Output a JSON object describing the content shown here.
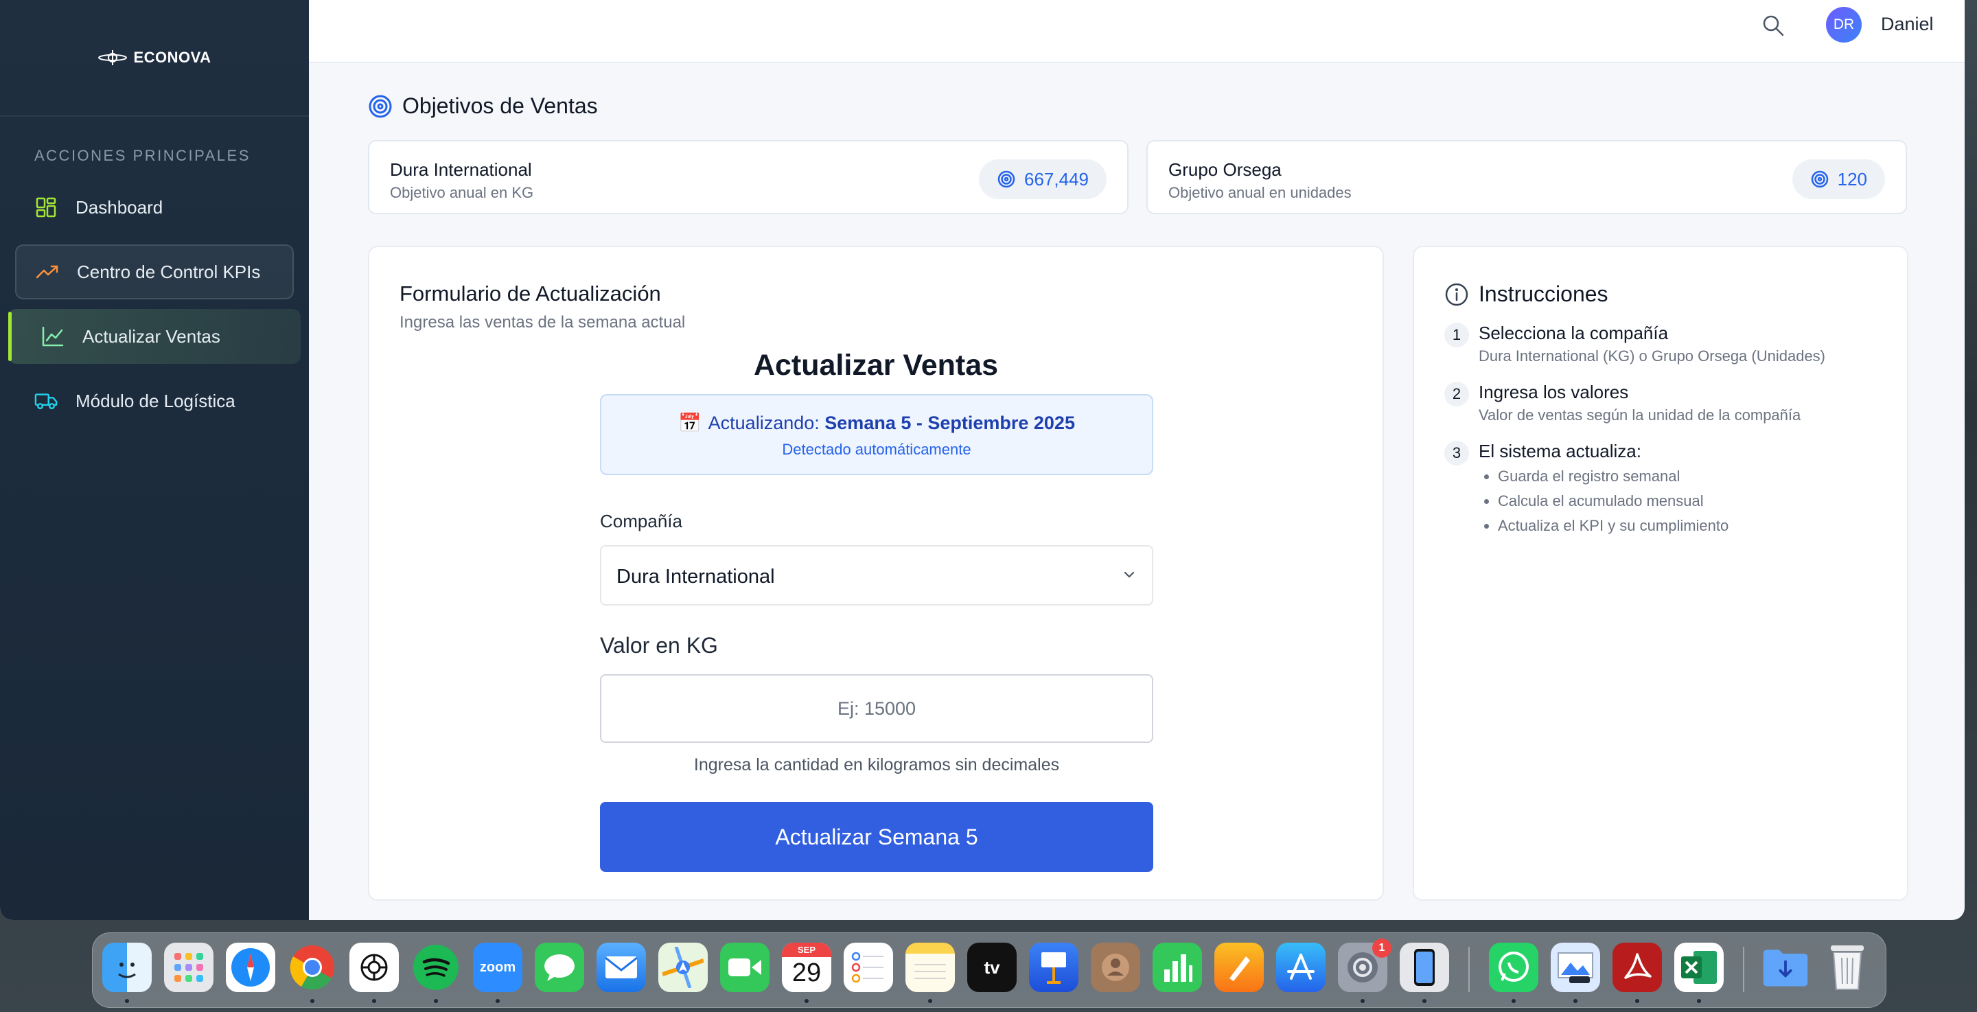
{
  "sidebar": {
    "logo_text": "ECONOVA",
    "section_title": "ACCIONES PRINCIPALES",
    "items": [
      {
        "label": "Dashboard",
        "icon": "grid-icon"
      },
      {
        "label": "Centro de Control KPIs",
        "icon": "trending-up-icon"
      },
      {
        "label": "Actualizar Ventas",
        "icon": "line-chart-icon",
        "active": true
      },
      {
        "label": "Módulo de Logística",
        "icon": "truck-icon"
      }
    ]
  },
  "header": {
    "avatar_initials": "DR",
    "user_name": "Daniel"
  },
  "page": {
    "title": "Objetivos de Ventas"
  },
  "targets": [
    {
      "name": "Dura International",
      "subtitle": "Objetivo anual en KG",
      "value": "667,449"
    },
    {
      "name": "Grupo Orsega",
      "subtitle": "Objetivo anual en unidades",
      "value": "120"
    }
  ],
  "form": {
    "title": "Formulario de Actualización",
    "subtitle": "Ingresa las ventas de la semana actual",
    "heading": "Actualizar Ventas",
    "week_emoji": "📅",
    "week_prefix": "Actualizando:",
    "week_value": "Semana 5 - Septiembre 2025",
    "week_detected": "Detectado automáticamente",
    "company_label": "Compañía",
    "company_selected": "Dura International",
    "value_label": "Valor en KG",
    "value_placeholder": "Ej: 15000",
    "value_hint": "Ingresa la cantidad en kilogramos sin decimales",
    "submit_label": "Actualizar Semana 5"
  },
  "instructions": {
    "title": "Instrucciones",
    "steps": [
      {
        "num": "1",
        "title": "Selecciona la compañía",
        "desc": "Dura International (KG) o Grupo Orsega (Unidades)"
      },
      {
        "num": "2",
        "title": "Ingresa los valores",
        "desc": "Valor de ventas según la unidad de la compañía"
      },
      {
        "num": "3",
        "title": "El sistema actualiza:",
        "bullets": [
          "Guarda el registro semanal",
          "Calcula el acumulado mensual",
          "Actualiza el KPI y su cumplimiento"
        ]
      }
    ]
  },
  "dock": {
    "calendar_month": "SEP",
    "calendar_day": "29",
    "zoom_label": "zoom",
    "appletv_label": "tv",
    "settings_badge": "1",
    "apps": [
      "finder",
      "launchpad",
      "safari",
      "chrome",
      "chatgpt",
      "spotify",
      "zoom",
      "messages",
      "mail",
      "maps",
      "facetime",
      "calendar",
      "reminders",
      "notes",
      "apple-tv",
      "keynote",
      "contacts",
      "numbers",
      "pages",
      "app-store",
      "system-settings",
      "iphone-mirroring",
      "whatsapp",
      "preview",
      "acrobat",
      "excel",
      "downloads",
      "trash"
    ]
  }
}
